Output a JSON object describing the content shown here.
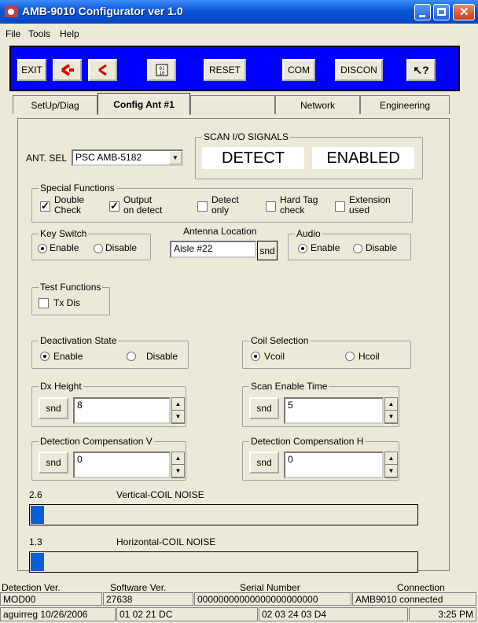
{
  "window": {
    "title": "AMB-9010 Configurator ver 1.0"
  },
  "menu": [
    "File",
    "Tools",
    "Help"
  ],
  "toolbar": {
    "exit": "EXIT",
    "reset": "RESET",
    "com": "COM",
    "discon": "DISCON"
  },
  "tabs": [
    "SetUp/Diag",
    "Config Ant #1",
    "",
    "Network",
    "Engineering"
  ],
  "scan": {
    "legend": "SCAN I/O SIGNALS",
    "left": "DETECT",
    "right": "ENABLED"
  },
  "ant_sel": {
    "label": "ANT. SEL",
    "value": "PSC AMB-5182"
  },
  "special": {
    "legend": "Special Functions",
    "items": [
      {
        "label": "Double\nCheck",
        "checked": true
      },
      {
        "label": "Output\non detect",
        "checked": true
      },
      {
        "label": "Detect\nonly",
        "checked": false
      },
      {
        "label": "Hard Tag\ncheck",
        "checked": false
      },
      {
        "label": "Extension\nused",
        "checked": false
      }
    ]
  },
  "key_switch": {
    "legend": "Key Switch",
    "enable": "Enable",
    "disable": "Disable"
  },
  "antenna_location": {
    "legend": "Antenna Location",
    "value": "Aisle #22",
    "send": "snd"
  },
  "audio": {
    "legend": "Audio",
    "enable": "Enable",
    "disable": "Disable"
  },
  "test": {
    "legend": "Test Functions",
    "txdis": "Tx Dis"
  },
  "deactivation": {
    "legend": "Deactivation State",
    "enable": "Enable",
    "disable": "Disable"
  },
  "coil": {
    "legend": "Coil Selection",
    "v": "Vcoil",
    "h": "Hcoil"
  },
  "dx_height": {
    "legend": "Dx Height",
    "send": "snd",
    "value": "8"
  },
  "scan_enable": {
    "legend": "Scan Enable Time",
    "send": "snd",
    "value": "5"
  },
  "det_comp_v": {
    "legend": "Detection Compensation V",
    "send": "snd",
    "value": "0"
  },
  "det_comp_h": {
    "legend": "Detection Compensation H",
    "send": "snd",
    "value": "0"
  },
  "noise_v": {
    "value": "2.6",
    "label": "Vertical-COIL NOISE",
    "level": 0.035
  },
  "noise_h": {
    "value": "1.3",
    "label": "Horizontal-COIL NOISE",
    "level": 0.035
  },
  "status": {
    "headers": [
      "Detection Ver.",
      "Software Ver.",
      "Serial Number",
      "Connection"
    ],
    "detection_ver": "MOD00",
    "software_ver": "27638",
    "serial": "00000000000000000000000",
    "connection": "AMB9010 connected",
    "user": "aguirreg 10/26/2006",
    "code1": "01 02 21 DC",
    "code2": "02 03 24 03 D4",
    "time": "3:25 PM"
  },
  "colors": {
    "toolbar_bg": "#0000FF",
    "titlebar": "#0A56D6",
    "progress": "#0A5FD6"
  }
}
